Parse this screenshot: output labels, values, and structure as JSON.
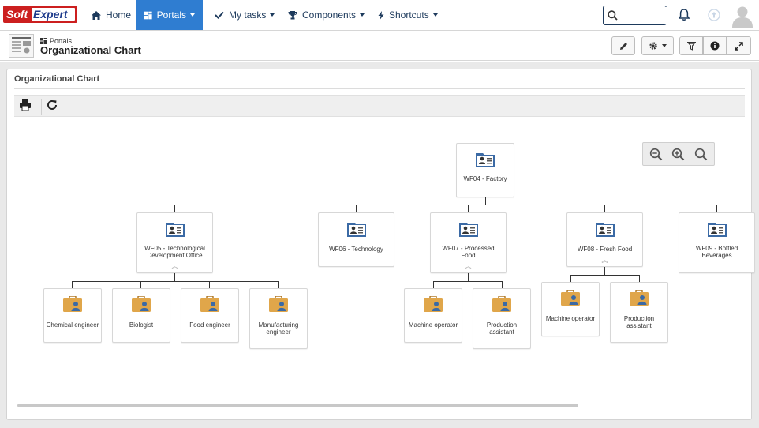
{
  "brand": {
    "part1": "Soft",
    "part2": "Expert",
    "color": "#cc1f1f"
  },
  "nav": {
    "home": "Home",
    "portals": "Portals",
    "my_tasks": "My tasks",
    "components": "Components",
    "shortcuts": "Shortcuts"
  },
  "search": {
    "placeholder": ""
  },
  "header": {
    "breadcrumb": "Portals",
    "title": "Organizational Chart"
  },
  "panel": {
    "title": "Organizational Chart"
  },
  "orgchart": {
    "root": {
      "label": "WF04 - Factory"
    },
    "departments": [
      {
        "label": "WF05 - Technological Development Office",
        "expandable": true
      },
      {
        "label": "WF06 - Technology",
        "expandable": false
      },
      {
        "label": "WF07 - Processed Food",
        "expandable": true
      },
      {
        "label": "WF08 - Fresh Food",
        "expandable": true
      },
      {
        "label": "WF09 - Bottled Beverages",
        "expandable": false
      }
    ],
    "roles_wf05": [
      "Chemical engineer",
      "Biologist",
      "Food engineer",
      "Manufacturing engineer"
    ],
    "roles_wf07": [
      "Machine operator",
      "Production assistant"
    ],
    "roles_wf08": [
      "Machine operator",
      "Production assistant"
    ]
  },
  "colors": {
    "accent": "#2f7dd1",
    "nav_text": "#1d3a5c",
    "role_icon": "#e0a64a",
    "dept_icon": "#3b6aa5"
  }
}
